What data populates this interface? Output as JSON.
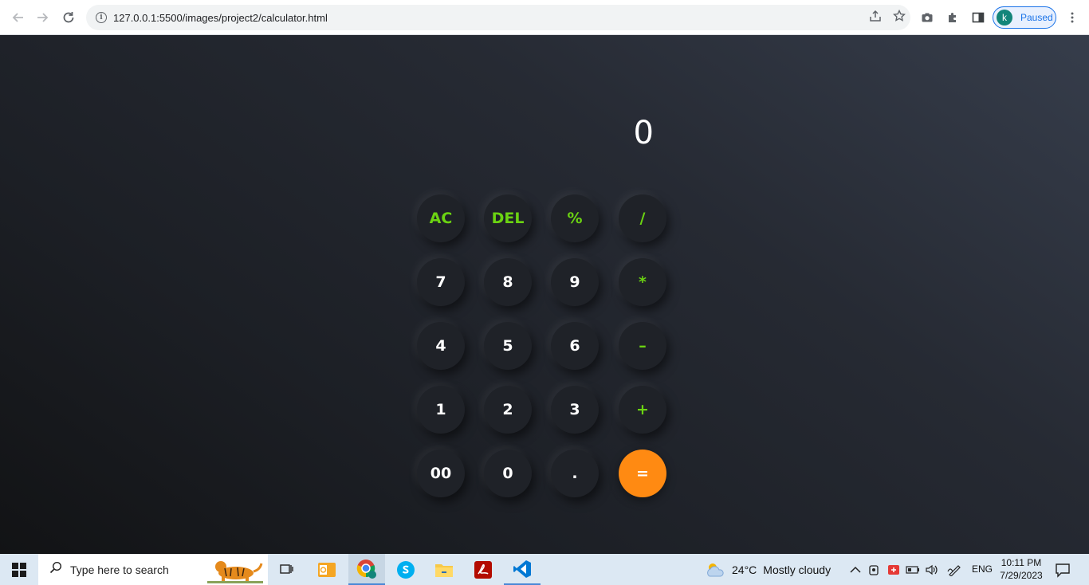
{
  "browser": {
    "url": "127.0.0.1:5500/images/project2/calculator.html",
    "profile_initial": "k",
    "profile_status": "Paused"
  },
  "calculator": {
    "display_value": "0",
    "keys": [
      [
        "AC",
        "DEL",
        "%",
        "/"
      ],
      [
        "7",
        "8",
        "9",
        "*"
      ],
      [
        "4",
        "5",
        "6",
        "–"
      ],
      [
        "1",
        "2",
        "3",
        "+"
      ],
      [
        "00",
        "0",
        ".",
        "="
      ]
    ],
    "colors": {
      "operator_text": "#6bd312",
      "equals_background": "#ff8a12",
      "key_background": "#1f2228"
    }
  },
  "taskbar": {
    "search_placeholder": "Type here to search",
    "weather_temp": "24°C",
    "weather_desc": "Mostly cloudy",
    "language": "ENG",
    "time": "10:11 PM",
    "date": "7/29/2023"
  }
}
